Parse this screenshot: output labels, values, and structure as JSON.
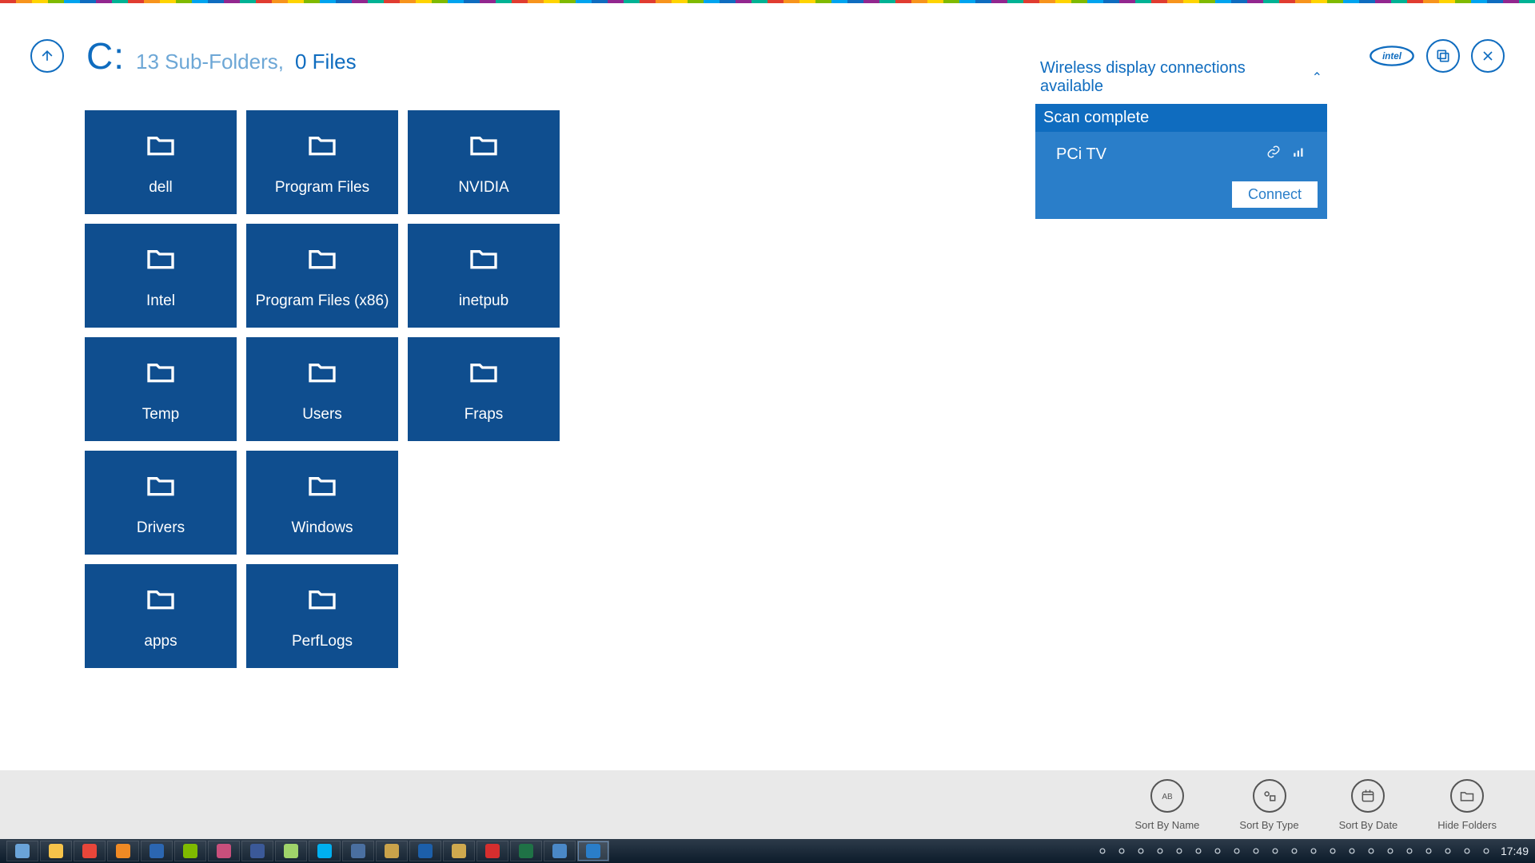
{
  "header": {
    "drive_label": "C:",
    "subfolders_label": "13 Sub-Folders,",
    "files_label": "0 Files"
  },
  "widi": {
    "title": "Wireless display connections available",
    "status": "Scan complete",
    "device_name": "PCi TV",
    "connect_label": "Connect"
  },
  "folders": [
    {
      "label": "dell"
    },
    {
      "label": "Program Files"
    },
    {
      "label": "NVIDIA"
    },
    {
      "label": "Intel"
    },
    {
      "label": "Program Files (x86)"
    },
    {
      "label": "inetpub"
    },
    {
      "label": "Temp"
    },
    {
      "label": "Users"
    },
    {
      "label": "Fraps"
    },
    {
      "label": "Drivers"
    },
    {
      "label": "Windows"
    },
    {
      "label": ""
    },
    {
      "label": "apps"
    },
    {
      "label": "PerfLogs"
    }
  ],
  "actions": [
    {
      "label": "Sort By Name"
    },
    {
      "label": "Sort By Type"
    },
    {
      "label": "Sort By Date"
    },
    {
      "label": "Hide Folders"
    }
  ],
  "taskbar": {
    "clock": "17:49",
    "apps": [
      {
        "name": "start",
        "c": "#6aa3d8"
      },
      {
        "name": "explorer",
        "c": "#f6c34a"
      },
      {
        "name": "chrome",
        "c": "#e8463a"
      },
      {
        "name": "vlc",
        "c": "#f08a24"
      },
      {
        "name": "outlook",
        "c": "#2b66b1"
      },
      {
        "name": "app",
        "c": "#7fba00"
      },
      {
        "name": "photos",
        "c": "#c94f7c"
      },
      {
        "name": "tweetdeck",
        "c": "#3b5998"
      },
      {
        "name": "notes",
        "c": "#9fd36a"
      },
      {
        "name": "skype",
        "c": "#00aff0"
      },
      {
        "name": "vm",
        "c": "#4a6fa0"
      },
      {
        "name": "steam",
        "c": "#c9a24a"
      },
      {
        "name": "teamviewer",
        "c": "#1c5faa"
      },
      {
        "name": "putty",
        "c": "#cfa94e"
      },
      {
        "name": "adobe",
        "c": "#d62e2e"
      },
      {
        "name": "excel",
        "c": "#1f7246"
      },
      {
        "name": "snip",
        "c": "#4a88c7"
      },
      {
        "name": "widi",
        "c": "#2a7ec9"
      }
    ],
    "tray": [
      "keyboard",
      "safely-remove",
      "chrome-bg",
      "dropbox",
      "facebook",
      "onedrive",
      "update",
      "antivirus",
      "outlook-bg",
      "audio",
      "bluetooth",
      "battery",
      "display",
      "sync",
      "network",
      "flag",
      "widi",
      "power",
      "wifi",
      "signal",
      "volume"
    ]
  },
  "colors": {
    "intel_blue": "#0f6cbf",
    "tile_blue": "#0f4e8f",
    "panel_blue": "#2a7ec9"
  }
}
